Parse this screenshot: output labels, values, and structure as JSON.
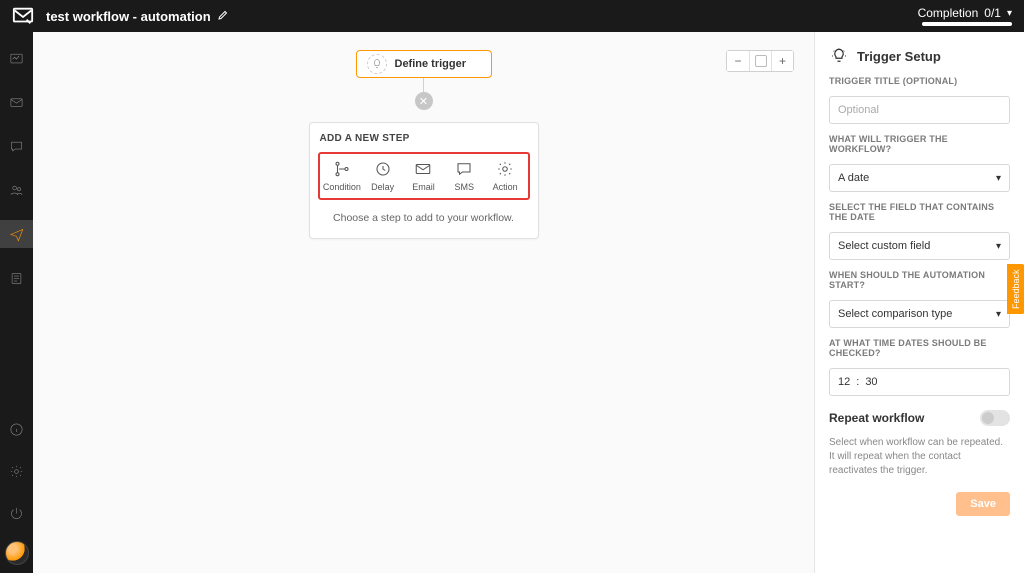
{
  "header": {
    "workflow_title": "test workflow - automation",
    "completion_label": "Completion",
    "completion_value": "0/1"
  },
  "canvas": {
    "trigger_node_label": "Define trigger",
    "step_card": {
      "title": "ADD A NEW STEP",
      "options": {
        "condition": "Condition",
        "delay": "Delay",
        "email": "Email",
        "sms": "SMS",
        "action": "Action"
      },
      "caption": "Choose a step to add to your workflow."
    },
    "zoom": {
      "minus": "−",
      "plus": "+"
    }
  },
  "panel": {
    "title": "Trigger Setup",
    "trigger_title_label": "TRIGGER TITLE (OPTIONAL)",
    "trigger_title_placeholder": "Optional",
    "what_trigger_label": "WHAT WILL TRIGGER THE WORKFLOW?",
    "what_trigger_value": "A date",
    "select_field_label": "SELECT THE FIELD THAT CONTAINS THE DATE",
    "select_field_value": "Select custom field",
    "when_start_label": "WHEN SHOULD THE AUTOMATION START?",
    "when_start_value": "Select comparison type",
    "time_label": "AT WHAT TIME DATES SHOULD BE CHECKED?",
    "time_hour": "12",
    "time_sep": ":",
    "time_min": "30",
    "repeat_label": "Repeat workflow",
    "repeat_help": "Select when workflow can be repeated. It will repeat when the contact reactivates the trigger.",
    "save_label": "Save"
  },
  "feedback": {
    "label": "Feedback"
  }
}
